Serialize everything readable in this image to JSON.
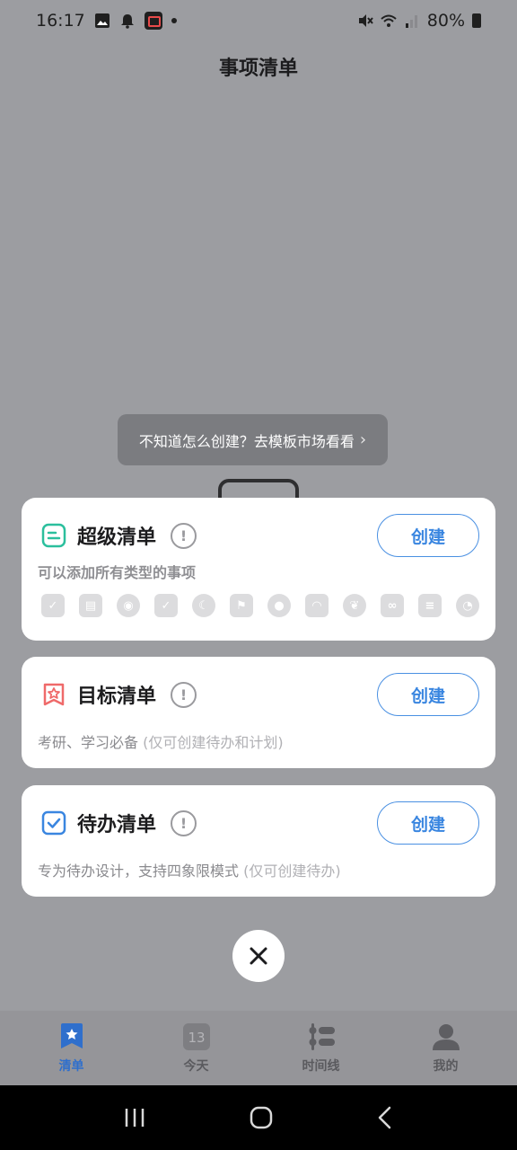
{
  "status_bar": {
    "time": "16:17",
    "battery": "80%",
    "icons_left": [
      "gallery-icon",
      "bell-icon",
      "screen-record-icon",
      "dot-icon"
    ],
    "icons_right": [
      "mute-icon",
      "wifi-icon",
      "signal-icon",
      "battery-icon"
    ]
  },
  "header": {
    "title": "事项清单"
  },
  "tooltip": {
    "text": "不知道怎么创建？去模板市场看看",
    "arrow": "›"
  },
  "cards": [
    {
      "title": "超级清单",
      "button": "创建",
      "description": "可以添加所有类型的事项",
      "note": "",
      "icon": "super-list-icon",
      "color": "#2bbf9d"
    },
    {
      "title": "目标清单",
      "button": "创建",
      "description": "考研、学习必备",
      "note": "(仅可创建待办和计划)",
      "icon": "goal-list-icon",
      "color": "#ef6a6a"
    },
    {
      "title": "待办清单",
      "button": "创建",
      "description": "专为待办设计，支持四象限模式",
      "note": "(仅可创建待办)",
      "icon": "todo-list-icon",
      "color": "#3a86e0"
    }
  ],
  "type_icons": [
    "checkbox-icon",
    "schedule-icon",
    "circle-icon",
    "calendar-check-icon",
    "moon-icon",
    "run-icon",
    "drop-icon",
    "gauge-icon",
    "leaf-icon",
    "habit-icon",
    "note-icon",
    "clock-icon"
  ],
  "info_symbol": "!",
  "tabs": [
    {
      "label": "清单",
      "icon": "star-list-icon",
      "active": true
    },
    {
      "label": "今天",
      "icon": "today-calendar-icon",
      "active": false,
      "day": "13"
    },
    {
      "label": "时间线",
      "icon": "timeline-icon",
      "active": false
    },
    {
      "label": "我的",
      "icon": "user-icon",
      "active": false
    }
  ],
  "colors": {
    "accent": "#3a86e0",
    "overlay": "#9c9da1"
  }
}
